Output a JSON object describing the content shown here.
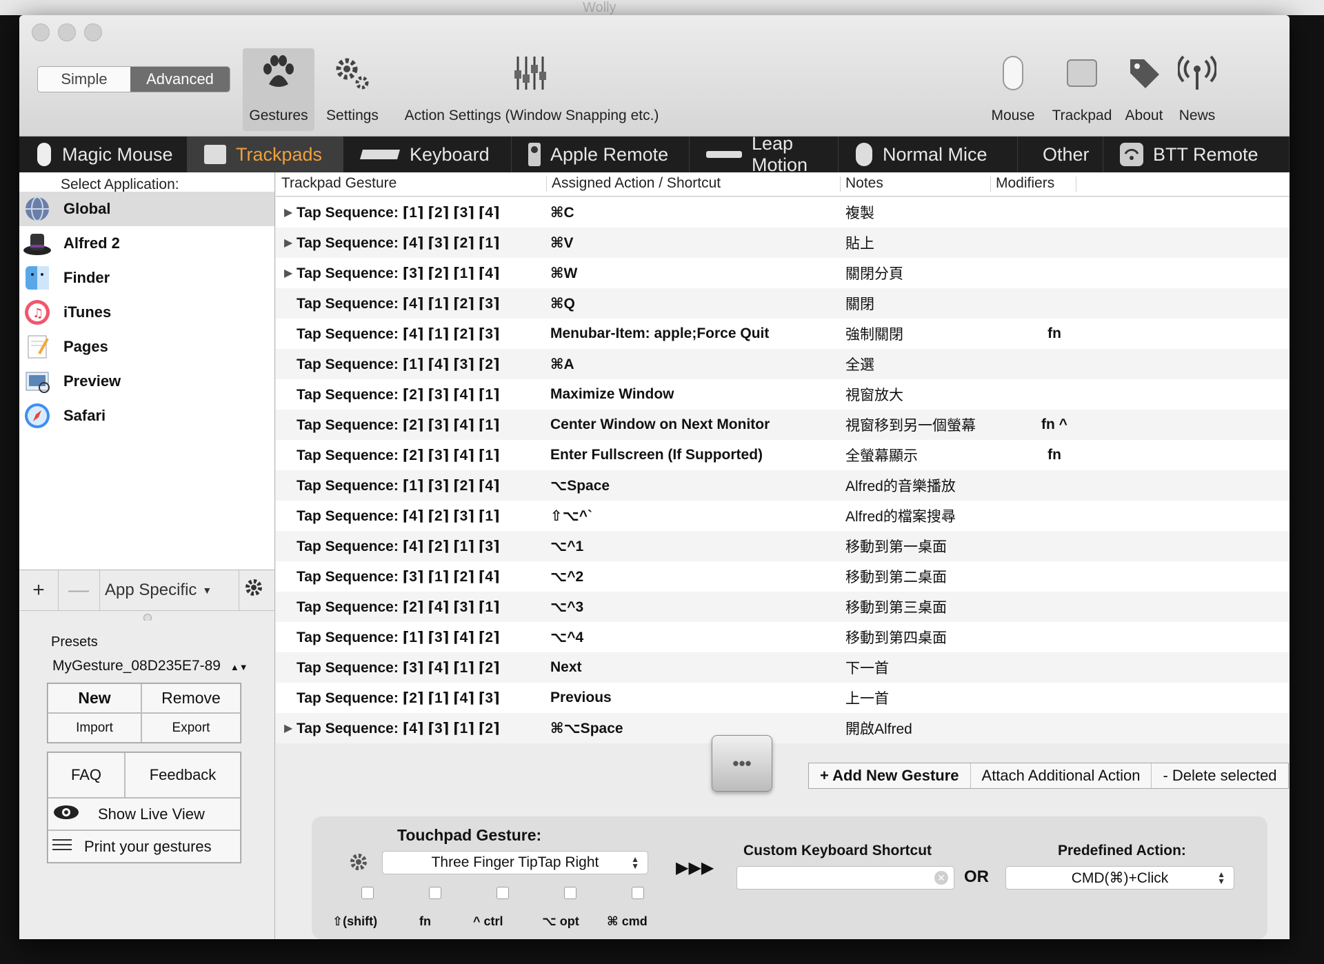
{
  "window_title": "Wolly",
  "toolbar": {
    "mode_simple": "Simple",
    "mode_advanced": "Advanced",
    "gestures": "Gestures",
    "settings": "Settings",
    "action_settings": "Action Settings (Window Snapping etc.)",
    "mouse": "Mouse",
    "trackpad": "Trackpad",
    "about": "About",
    "news": "News"
  },
  "devices": [
    "Magic Mouse",
    "Trackpads",
    "Keyboard",
    "Apple Remote",
    "Leap Motion",
    "Normal Mice",
    "Other",
    "BTT Remote"
  ],
  "sidebar": {
    "header": "Select Application:",
    "apps": [
      "Global",
      "Alfred 2",
      "Finder",
      "iTunes",
      "Pages",
      "Preview",
      "Safari"
    ],
    "add": "+",
    "remove": "—",
    "app_specific": "App Specific",
    "presets_title": "Presets",
    "preset_value": "MyGesture_08D235E7-89",
    "new": "New",
    "remove_btn": "Remove",
    "import": "Import",
    "export": "Export",
    "faq": "FAQ",
    "feedback": "Feedback",
    "show_live_view": "Show Live View",
    "print_gestures": "Print your gestures"
  },
  "table": {
    "headers": [
      "Trackpad Gesture",
      "Assigned Action / Shortcut",
      "Notes",
      "Modifiers"
    ],
    "rows": [
      {
        "gesture": "Tap Sequence: ⌈1⌉ ⌈2⌉ ⌈3⌉ ⌈4⌉",
        "action": "⌘C",
        "notes": "複製",
        "mod": "",
        "expand": "▶"
      },
      {
        "gesture": "Tap Sequence: ⌈4⌉ ⌈3⌉ ⌈2⌉ ⌈1⌉",
        "action": "⌘V",
        "notes": "貼上",
        "mod": "",
        "expand": "▶"
      },
      {
        "gesture": "Tap Sequence: ⌈3⌉ ⌈2⌉ ⌈1⌉ ⌈4⌉",
        "action": "⌘W",
        "notes": "關閉分頁",
        "mod": "",
        "expand": "▶"
      },
      {
        "gesture": "Tap Sequence: ⌈4⌉ ⌈1⌉ ⌈2⌉ ⌈3⌉",
        "action": "⌘Q",
        "notes": "關閉",
        "mod": "",
        "expand": ""
      },
      {
        "gesture": "Tap Sequence: ⌈4⌉ ⌈1⌉ ⌈2⌉ ⌈3⌉",
        "action": "Menubar-Item: apple;Force Quit",
        "notes": "強制關閉",
        "mod": "fn",
        "expand": ""
      },
      {
        "gesture": "Tap Sequence: ⌈1⌉ ⌈4⌉ ⌈3⌉ ⌈2⌉",
        "action": "⌘A",
        "notes": "全選",
        "mod": "",
        "expand": ""
      },
      {
        "gesture": "Tap Sequence: ⌈2⌉ ⌈3⌉ ⌈4⌉ ⌈1⌉",
        "action": "Maximize Window",
        "notes": "視窗放大",
        "mod": "",
        "expand": ""
      },
      {
        "gesture": "Tap Sequence: ⌈2⌉ ⌈3⌉ ⌈4⌉ ⌈1⌉",
        "action": "Center Window on Next Monitor",
        "notes": "視窗移到另一個螢幕",
        "mod": "fn ^",
        "expand": ""
      },
      {
        "gesture": "Tap Sequence: ⌈2⌉ ⌈3⌉ ⌈4⌉ ⌈1⌉",
        "action": "Enter Fullscreen (If Supported)",
        "notes": "全螢幕顯示",
        "mod": "fn",
        "expand": ""
      },
      {
        "gesture": "Tap Sequence: ⌈1⌉ ⌈3⌉ ⌈2⌉ ⌈4⌉",
        "action": "⌥Space",
        "notes": "Alfred的音樂播放",
        "mod": "",
        "expand": ""
      },
      {
        "gesture": "Tap Sequence: ⌈4⌉ ⌈2⌉ ⌈3⌉ ⌈1⌉",
        "action": "⇧⌥^`",
        "notes": "Alfred的檔案搜尋",
        "mod": "",
        "expand": ""
      },
      {
        "gesture": "Tap Sequence: ⌈4⌉ ⌈2⌉ ⌈1⌉ ⌈3⌉",
        "action": "⌥^1",
        "notes": "移動到第一桌面",
        "mod": "",
        "expand": ""
      },
      {
        "gesture": "Tap Sequence: ⌈3⌉ ⌈1⌉ ⌈2⌉ ⌈4⌉",
        "action": "⌥^2",
        "notes": "移動到第二桌面",
        "mod": "",
        "expand": ""
      },
      {
        "gesture": "Tap Sequence: ⌈2⌉ ⌈4⌉ ⌈3⌉ ⌈1⌉",
        "action": "⌥^3",
        "notes": "移動到第三桌面",
        "mod": "",
        "expand": ""
      },
      {
        "gesture": "Tap Sequence: ⌈1⌉ ⌈3⌉ ⌈4⌉ ⌈2⌉",
        "action": "⌥^4",
        "notes": "移動到第四桌面",
        "mod": "",
        "expand": ""
      },
      {
        "gesture": "Tap Sequence: ⌈3⌉ ⌈4⌉ ⌈1⌉ ⌈2⌉",
        "action": "Next",
        "notes": "下一首",
        "mod": "",
        "expand": ""
      },
      {
        "gesture": "Tap Sequence: ⌈2⌉ ⌈1⌉ ⌈4⌉ ⌈3⌉",
        "action": "Previous",
        "notes": "上一首",
        "mod": "",
        "expand": ""
      },
      {
        "gesture": "Tap Sequence: ⌈4⌉ ⌈3⌉ ⌈1⌉ ⌈2⌉",
        "action": "⌘⌥Space",
        "notes": "開啟Alfred",
        "mod": "",
        "expand": "▶"
      }
    ]
  },
  "actions": {
    "add_new": "+ Add New Gesture",
    "attach": "Attach Additional Action",
    "delete": "- Delete selected",
    "more": "•••"
  },
  "editor": {
    "touchpad_title": "Touchpad Gesture:",
    "gesture_value": "Three Finger TipTap Right",
    "arrows": "▶▶▶",
    "custom_title": "Custom Keyboard Shortcut",
    "or": "OR",
    "predefined_title": "Predefined Action:",
    "predefined_value": "CMD(⌘)+Click",
    "modifiers": [
      "⇧(shift)",
      "fn",
      "^ ctrl",
      "⌥ opt",
      "⌘ cmd"
    ]
  }
}
